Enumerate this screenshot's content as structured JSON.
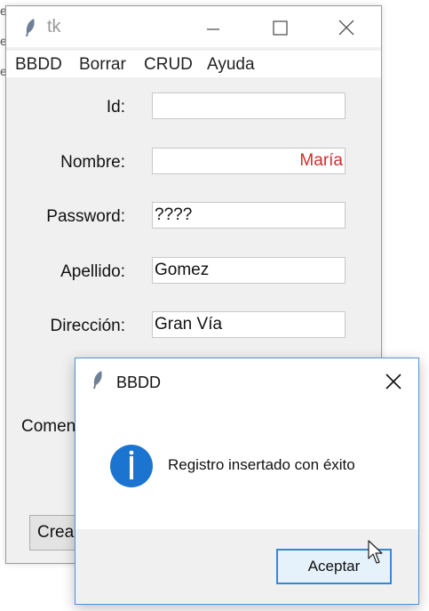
{
  "background_fragments": [
    "e",
    "e",
    "e"
  ],
  "main_window": {
    "title": "tk",
    "menu": [
      "BBDD",
      "Borrar",
      "CRUD",
      "Ayuda"
    ],
    "fields": [
      {
        "label": "Id:",
        "value": ""
      },
      {
        "label": "Nombre:",
        "value": "María"
      },
      {
        "label": "Password:",
        "value": "????"
      },
      {
        "label": "Apellido:",
        "value": "Gomez"
      },
      {
        "label": "Dirección:",
        "value": "Gran Vía"
      }
    ],
    "partial_comment_label": "Comen",
    "partial_create_button": "Crea",
    "nombre_text_color": "#d12d2d"
  },
  "dialog": {
    "title": "BBDD",
    "icon": "info-icon",
    "message": "Registro insertado con éxito",
    "accept_label": "Aceptar",
    "accent_color": "#1a74d0"
  }
}
